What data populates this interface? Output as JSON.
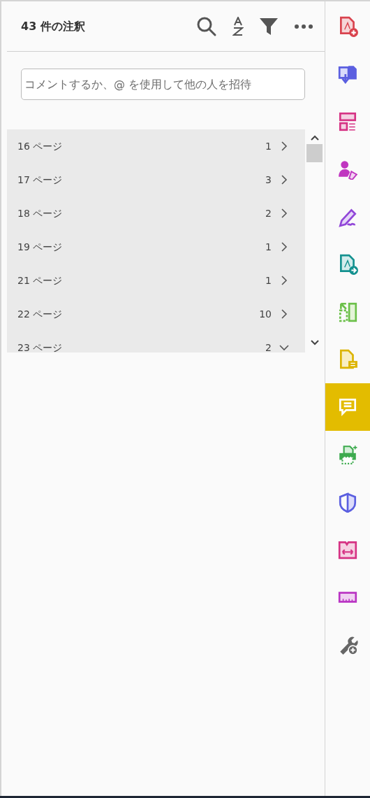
{
  "panel": {
    "title": "43 件の注釈",
    "comment_field": {
      "placeholder": "コメントするか、@ を使用して他の人を招待"
    }
  },
  "pages": [
    {
      "label": "16 ページ",
      "count": "1",
      "expanded": false
    },
    {
      "label": "17 ページ",
      "count": "3",
      "expanded": false
    },
    {
      "label": "18 ページ",
      "count": "2",
      "expanded": false
    },
    {
      "label": "19 ページ",
      "count": "1",
      "expanded": false
    },
    {
      "label": "21 ページ",
      "count": "1",
      "expanded": false
    },
    {
      "label": "22 ページ",
      "count": "10",
      "expanded": false
    },
    {
      "label": "23 ページ",
      "count": "2",
      "expanded": true
    }
  ],
  "tools": [
    {
      "selected": false
    },
    {
      "selected": false
    },
    {
      "selected": false
    },
    {
      "selected": false
    },
    {
      "selected": false
    },
    {
      "selected": false
    },
    {
      "selected": false
    },
    {
      "selected": false
    },
    {
      "selected": true
    },
    {
      "selected": false
    },
    {
      "selected": false
    },
    {
      "selected": false
    },
    {
      "selected": false
    },
    {
      "selected": false
    }
  ]
}
